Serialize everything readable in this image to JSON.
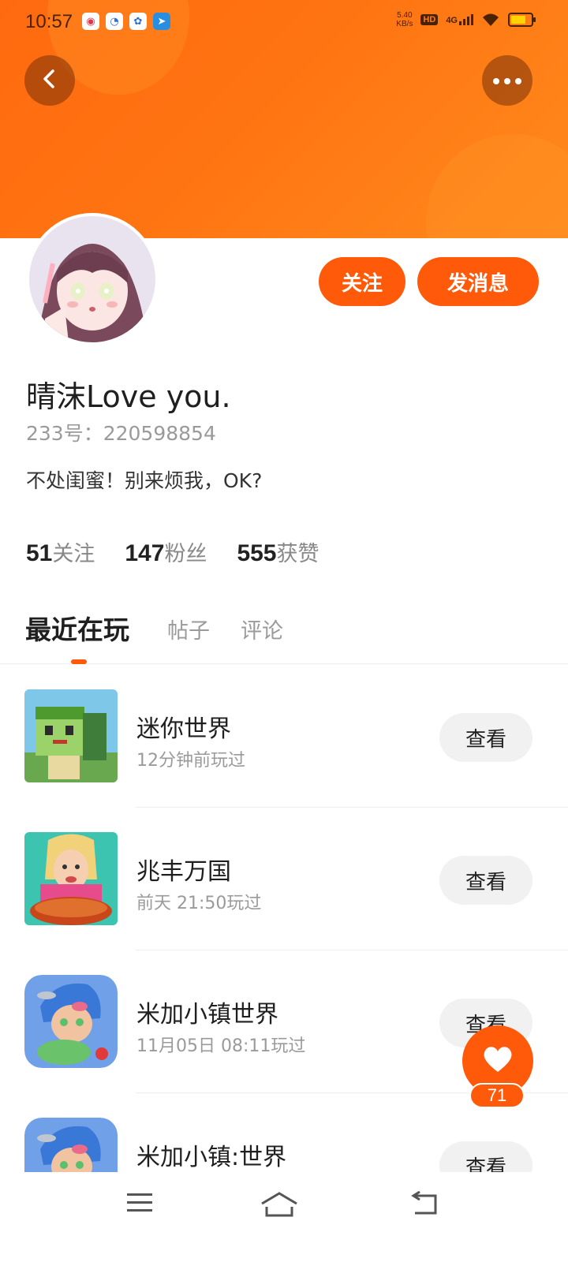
{
  "status_bar": {
    "time": "10:57",
    "net_speed_value": "5.40",
    "net_speed_unit": "KB/s",
    "hd": "HD",
    "network": "4G",
    "icons": [
      "xiaohongshu-icon",
      "browser-icon",
      "baidu-icon",
      "telegram-icon",
      "wifi-icon",
      "battery-icon"
    ]
  },
  "header": {
    "back_icon": "chevron-left-icon",
    "more_icon": "more-dots-icon",
    "accent_color": "#ff5a0a"
  },
  "profile": {
    "username": "晴沫Love  you.",
    "uid": "233号：220598854",
    "bio": "不处闺蜜！别来烦我，OK?",
    "follow_label": "关注",
    "message_label": "发消息",
    "stats": [
      {
        "num": "51",
        "label": "关注"
      },
      {
        "num": "147",
        "label": "粉丝"
      },
      {
        "num": "555",
        "label": "获赞"
      }
    ]
  },
  "tabs": [
    {
      "label": "最近在玩",
      "active": true
    },
    {
      "label": "帖子",
      "active": false
    },
    {
      "label": "评论",
      "active": false
    }
  ],
  "games": [
    {
      "name": "迷你世界",
      "time": "12分钟前玩过",
      "button": "查看"
    },
    {
      "name": "兆丰万国",
      "time": "前天  21:50玩过",
      "button": "查看"
    },
    {
      "name": "米加小镇世界",
      "time": "11月05日  08:11玩过",
      "button": "查看"
    },
    {
      "name": "米加小镇:世界",
      "time": "",
      "button": "查看"
    }
  ],
  "like": {
    "count": "71",
    "icon": "heart-icon"
  },
  "nav": {
    "icons": [
      "menu-icon",
      "home-icon",
      "back-icon"
    ]
  }
}
